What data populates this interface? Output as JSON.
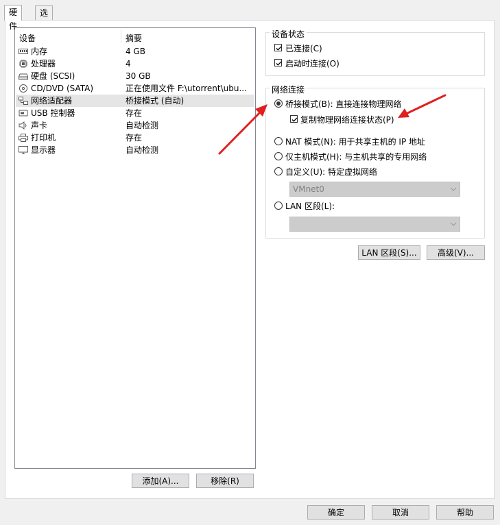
{
  "tabs": [
    {
      "label": "硬件"
    },
    {
      "label": "选项"
    }
  ],
  "device_list": {
    "col_device": "设备",
    "col_summary": "摘要",
    "rows": [
      {
        "name": "内存",
        "summary": "4 GB",
        "icon": "memory-icon"
      },
      {
        "name": "处理器",
        "summary": "4",
        "icon": "cpu-icon"
      },
      {
        "name": "硬盘 (SCSI)",
        "summary": "30 GB",
        "icon": "hard-disk-icon"
      },
      {
        "name": "CD/DVD (SATA)",
        "summary": "正在使用文件 F:\\utorrent\\ubu...",
        "icon": "cd-dvd-icon"
      },
      {
        "name": "网络适配器",
        "summary": "桥接模式 (自动)",
        "icon": "network-adapter-icon"
      },
      {
        "name": "USB 控制器",
        "summary": "存在",
        "icon": "usb-icon"
      },
      {
        "name": "声卡",
        "summary": "自动检测",
        "icon": "speaker-icon"
      },
      {
        "name": "打印机",
        "summary": "存在",
        "icon": "printer-icon"
      },
      {
        "name": "显示器",
        "summary": "自动检测",
        "icon": "monitor-icon"
      }
    ],
    "selected_index": 4
  },
  "buttons": {
    "add": "添加(A)...",
    "remove": "移除(R)",
    "lan_segments": "LAN 区段(S)...",
    "advanced": "高级(V)...",
    "ok": "确定",
    "cancel": "取消",
    "help": "帮助"
  },
  "device_status": {
    "title": "设备状态",
    "connected": {
      "label": "已连接(C)",
      "checked": true
    },
    "connect_at_power_on": {
      "label": "启动时连接(O)",
      "checked": true
    }
  },
  "network_connection": {
    "title": "网络连接",
    "bridged": {
      "label": "桥接模式(B): 直接连接物理网络",
      "selected": true
    },
    "replicate": {
      "label": "复制物理网络连接状态(P)",
      "checked": true
    },
    "nat": {
      "label": "NAT 模式(N): 用于共享主机的 IP 地址",
      "selected": false
    },
    "host_only": {
      "label": "仅主机模式(H): 与主机共享的专用网络",
      "selected": false
    },
    "custom": {
      "label": "自定义(U): 特定虚拟网络",
      "selected": false
    },
    "custom_value": "VMnet0",
    "lan_segment": {
      "label": "LAN 区段(L):",
      "selected": false
    },
    "lan_segment_value": ""
  },
  "colors": {
    "annotation_arrow": "#e02020",
    "selection": "#e5e5e5"
  }
}
